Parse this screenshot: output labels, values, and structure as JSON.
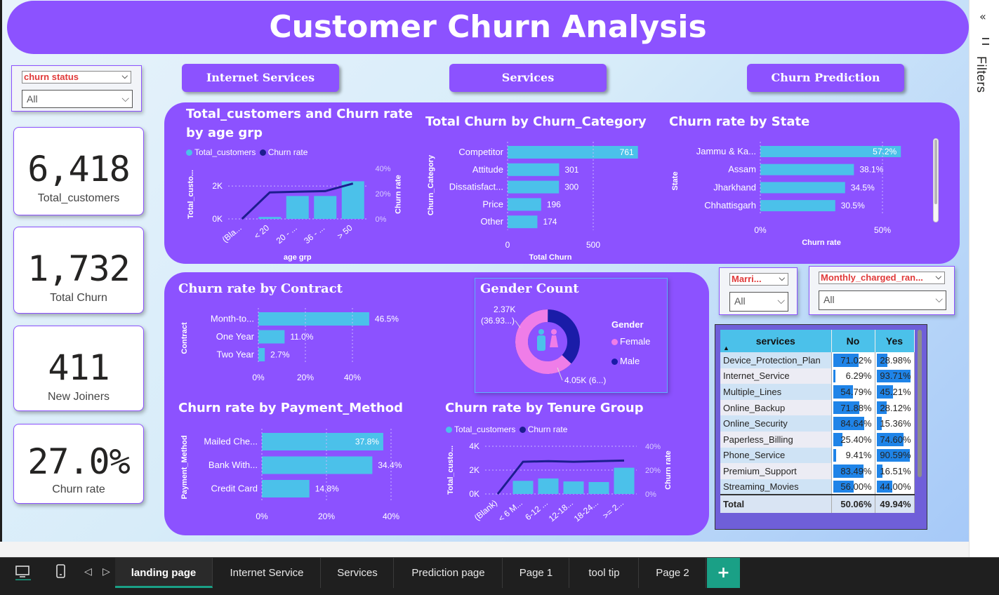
{
  "header": {
    "title": "Customer Churn Analysis"
  },
  "filters_pane": {
    "label": "Filters"
  },
  "slicers": {
    "churn_status": {
      "title": "churn status",
      "value": "All"
    },
    "married": {
      "title": "Marri...",
      "value": "All"
    },
    "monthly_charge": {
      "title": "Monthly_charged_ran...",
      "value": "All"
    }
  },
  "kpis": [
    {
      "value": "6,418",
      "label": "Total_customers"
    },
    {
      "value": "1,732",
      "label": "Total Churn"
    },
    {
      "value": "411",
      "label": "New Joiners"
    },
    {
      "value": "27.0%",
      "label": "Churn rate"
    }
  ],
  "nav_buttons": [
    "Internet Services",
    "Services",
    "Churn Prediction"
  ],
  "charts_text": {
    "age": {
      "title_line1": "Total_customers and Churn rate",
      "title_line2": "by age grp",
      "leg1": "Total_customers",
      "leg2": "Churn rate"
    },
    "category": {
      "title": "Total Churn by Churn_Category"
    },
    "state": {
      "title": "Churn rate by State"
    },
    "contract": {
      "title": "Churn rate by Contract"
    },
    "gender": {
      "title": "Gender Count",
      "legend_title": "Gender",
      "female": "Female",
      "male": "Male",
      "label_male_1": "2.37K",
      "label_male_2": "(36.93...)",
      "label_female": "4.05K (6...)"
    },
    "payment": {
      "title": "Churn rate by Payment_Method"
    },
    "tenure": {
      "title": "Churn rate by Tenure Group",
      "leg1": "Total_customers",
      "leg2": "Churn rate"
    }
  },
  "colors": {
    "purple": "#8c52ff",
    "cyan": "#4bc1ea",
    "navy": "#1d1d8f",
    "female": "#ef7de8",
    "male": "#1a1ca8"
  },
  "chart_data": [
    {
      "type": "bar",
      "title": "Total_customers and Churn rate by age grp",
      "categories": [
        "(Bla...",
        "< 20",
        "20 - ...",
        "36 - ...",
        "> 50"
      ],
      "xlabel": "age grp",
      "ylabel": "Total_custo...",
      "y2label": "Churn rate",
      "series": [
        {
          "name": "Total_customers",
          "kind": "bar",
          "values": [
            0,
            120,
            1400,
            1400,
            2300
          ]
        },
        {
          "name": "Churn rate",
          "kind": "line",
          "values": [
            0,
            21,
            21.5,
            22,
            28
          ]
        }
      ],
      "yticks": [
        "0K",
        "2K"
      ],
      "y2ticks": [
        "0%",
        "20%",
        "40%"
      ]
    },
    {
      "type": "bar",
      "title": "Total Churn by Churn_Category",
      "categories": [
        "Competitor",
        "Attitude",
        "Dissatisfact...",
        "Price",
        "Other"
      ],
      "values": [
        761,
        301,
        300,
        196,
        174
      ],
      "xlabel": "Total Churn",
      "ylabel": "Churn_Category",
      "xticks": [
        "0",
        "500"
      ],
      "xlim": [
        0,
        1000
      ]
    },
    {
      "type": "bar",
      "title": "Churn rate by State",
      "categories": [
        "Jammu & Ka...",
        "Assam",
        "Jharkhand",
        "Chhattisgarh"
      ],
      "values": [
        57.2,
        38.1,
        34.5,
        30.5
      ],
      "labels": [
        "57.2%",
        "38.1%",
        "34.5%",
        "30.5%"
      ],
      "xlabel": "Churn rate",
      "ylabel": "State",
      "xticks": [
        "0%",
        "50%"
      ],
      "xlim": [
        0,
        60
      ]
    },
    {
      "type": "bar",
      "title": "Churn rate by Contract",
      "categories": [
        "Month-to...",
        "One Year",
        "Two Year"
      ],
      "values": [
        46.5,
        11.0,
        2.7
      ],
      "labels": [
        "46.5%",
        "11.0%",
        "2.7%"
      ],
      "ylabel": "Contract",
      "xticks": [
        "0%",
        "20%",
        "40%"
      ],
      "xlim": [
        0,
        48
      ]
    },
    {
      "type": "pie",
      "title": "Gender Count",
      "series": [
        {
          "name": "Female",
          "value": 4050,
          "label": "4.05K (6...)"
        },
        {
          "name": "Male",
          "value": 2370,
          "label": "2.37K (36.93...)"
        }
      ]
    },
    {
      "type": "bar",
      "title": "Churn rate by Payment_Method",
      "categories": [
        "Mailed Che...",
        "Bank With...",
        "Credit Card"
      ],
      "values": [
        37.8,
        34.4,
        14.8
      ],
      "labels": [
        "37.8%",
        "34.4%",
        "14.8%"
      ],
      "ylabel": "Payment_Method",
      "xticks": [
        "0%",
        "20%",
        "40%"
      ],
      "xlim": [
        0,
        40
      ]
    },
    {
      "type": "bar",
      "title": "Churn rate by Tenure Group",
      "categories": [
        "(Blank)",
        "< 6 M...",
        "6-12 ...",
        "12-18...",
        "18-24...",
        ">= 2..."
      ],
      "xlabel": "",
      "ylabel": "Total_custo...",
      "y2label": "Churn rate",
      "series": [
        {
          "name": "Total_customers",
          "kind": "bar",
          "values": [
            0,
            1100,
            1300,
            1050,
            1000,
            2200
          ]
        },
        {
          "name": "Churn rate",
          "kind": "line",
          "values": [
            0,
            27,
            27.5,
            27,
            27.5,
            28
          ]
        }
      ],
      "yticks": [
        "0K",
        "2K",
        "4K"
      ],
      "y2ticks": [
        "0%",
        "20%",
        "40%"
      ]
    },
    {
      "type": "table",
      "columns": [
        "services",
        "No",
        "Yes"
      ],
      "rows": [
        [
          "Device_Protection_Plan",
          "71.02%",
          "28.98%"
        ],
        [
          "Internet_Service",
          "6.29%",
          "93.71%"
        ],
        [
          "Multiple_Lines",
          "54.79%",
          "45.21%"
        ],
        [
          "Online_Backup",
          "71.88%",
          "28.12%"
        ],
        [
          "Online_Security",
          "84.64%",
          "15.36%"
        ],
        [
          "Paperless_Billing",
          "25.40%",
          "74.60%"
        ],
        [
          "Phone_Service",
          "9.41%",
          "90.59%"
        ],
        [
          "Premium_Support",
          "83.49%",
          "16.51%"
        ],
        [
          "Streaming_Movies",
          "56.00%",
          "44.00%"
        ]
      ],
      "total": [
        "Total",
        "50.06%",
        "49.94%"
      ]
    }
  ],
  "tabs": [
    "landing page",
    "Internet Service",
    "Services",
    "Prediction page",
    "Page 1",
    "tool tip",
    "Page 2"
  ]
}
